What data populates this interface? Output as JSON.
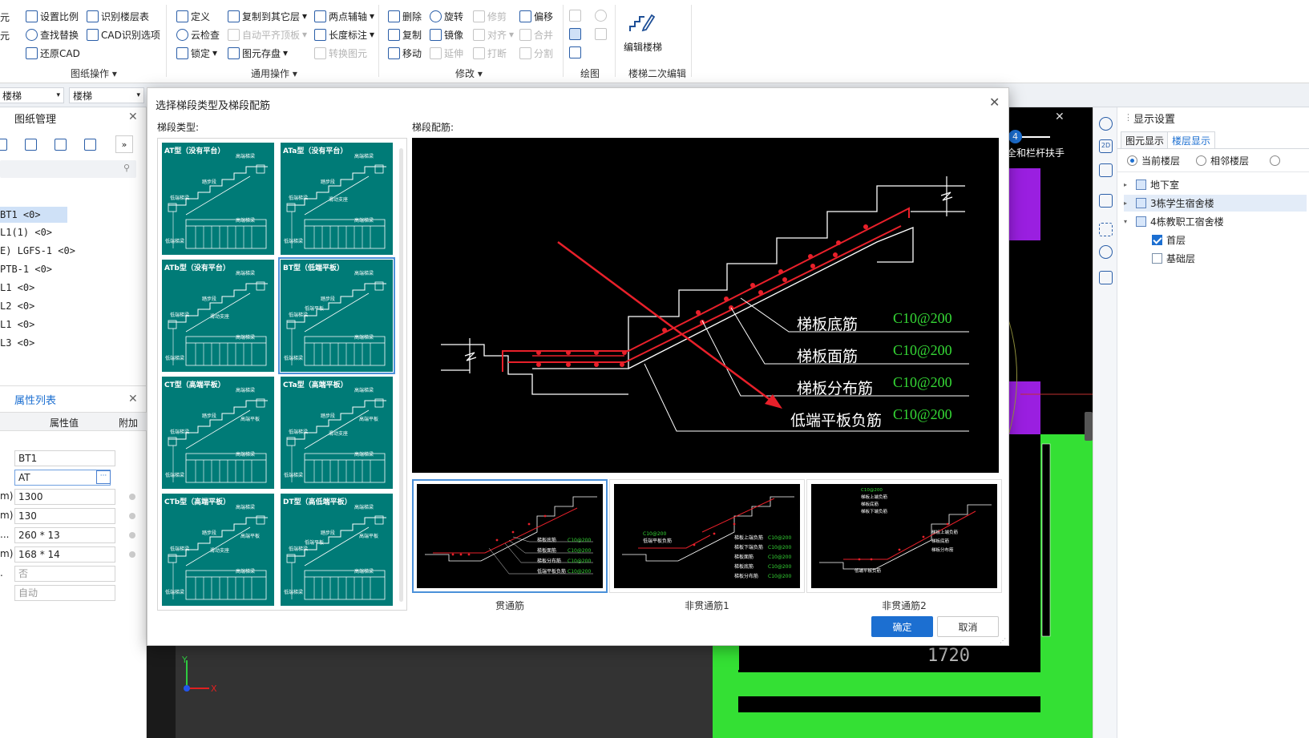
{
  "ribbon": {
    "col0": [
      "元",
      "元"
    ],
    "drawing_ops": {
      "items": [
        "设置比例",
        "识别楼层表",
        "查找替换",
        "CAD识别选项",
        "还原CAD"
      ],
      "label": "图纸操作"
    },
    "general_ops": {
      "items": [
        "定义",
        "复制到其它层",
        "两点辅轴",
        "云检查",
        "自动平齐顶板",
        "长度标注",
        "锁定",
        "图元存盘",
        "转换图元"
      ],
      "label": "通用操作"
    },
    "modify": {
      "items": [
        "删除",
        "旋转",
        "修剪",
        "偏移",
        "复制",
        "镜像",
        "对齐",
        "合并",
        "移动",
        "延伸",
        "打断",
        "分割"
      ],
      "label": "修改"
    },
    "draw": {
      "label": "绘图"
    },
    "stair_edit": {
      "button": "编辑楼梯",
      "label": "楼梯二次编辑"
    }
  },
  "toolbar2": {
    "combo1": "楼梯",
    "combo2": "楼梯"
  },
  "left": {
    "drawing_mgmt_title": "图纸管理",
    "tree_items": [
      "BT1 <0>",
      "L1(1) <0>",
      "E) LGFS-1 <0>",
      "PTB-1 <0>",
      "L1 <0>",
      "L2 <0>",
      "L1 <0>",
      "L3 <0>"
    ],
    "props_title": "属性列表",
    "props_col_value": "属性值",
    "props_col_add": "附加",
    "props_rows": [
      {
        "key": "",
        "value": "BT1"
      },
      {
        "key": "",
        "value": "AT"
      },
      {
        "key": "m)",
        "value": "1300"
      },
      {
        "key": "m)",
        "value": "130"
      },
      {
        "key": "...",
        "value": "260 * 13"
      },
      {
        "key": "m)",
        "value": "168 * 14"
      },
      {
        "key": ".",
        "value": "否"
      },
      {
        "key": "",
        "value": "自动"
      }
    ]
  },
  "canvas": {
    "label_top": "全和栏杆扶手",
    "step_badge": "4",
    "dimension": "1720"
  },
  "right": {
    "title": "显示设置",
    "tabs": [
      "图元显示",
      "楼层显示"
    ],
    "radios": [
      "当前楼层",
      "相邻楼层"
    ],
    "floors": [
      {
        "name": "地下室",
        "level": 0,
        "checked": false
      },
      {
        "name": "3栋学生宿舍楼",
        "level": 0,
        "checked": false,
        "highlight": true
      },
      {
        "name": "4栋教职工宿舍楼",
        "level": 0,
        "checked": false,
        "expanded": true
      },
      {
        "name": "首层",
        "level": 1,
        "checked": true
      },
      {
        "name": "基础层",
        "level": 1,
        "checked": false
      }
    ]
  },
  "dialog": {
    "title": "选择梯段类型及梯段配筋",
    "types_label": "梯段类型:",
    "rebar_label": "梯段配筋:",
    "types": [
      {
        "name": "AT型（没有平台）",
        "selected": false
      },
      {
        "name": "ATa型（没有平台）",
        "selected": false
      },
      {
        "name": "ATb型（没有平台）",
        "selected": false
      },
      {
        "name": "BT型（低端平板）",
        "selected": true
      },
      {
        "name": "CT型（高端平板）",
        "selected": false
      },
      {
        "name": "CTa型（高端平板）",
        "selected": false
      },
      {
        "name": "CTb型（高端平板）",
        "selected": false
      },
      {
        "name": "DT型（高低端平板）",
        "selected": false
      }
    ],
    "thumb_labels": {
      "low_beam": "低端梯梁",
      "high_beam": "高端梯梁",
      "step": "踏步段",
      "low_slab": "低端平板",
      "high_slab": "高端平板",
      "slide_support": "滑动支座",
      "slide_support_alt": "滑动支座"
    },
    "rebar_lines": [
      {
        "name": "梯板底筋",
        "spec": "C10@200"
      },
      {
        "name": "梯板面筋",
        "spec": "C10@200"
      },
      {
        "name": "梯板分布筋",
        "spec": "C10@200"
      },
      {
        "name": "低端平板负筋",
        "spec": "C10@200"
      }
    ],
    "variant_thumb": {
      "v1": [
        "梯板底筋",
        "梯板面筋",
        "梯板分布筋",
        "低端平板负筋"
      ],
      "v2_left": "低端平板负筋",
      "v2": [
        "梯板上端负筋",
        "梯板下端负筋",
        "梯板面筋",
        "梯板底筋",
        "梯板分布筋"
      ],
      "v3_top": [
        "梯板上端负筋",
        "梯板底筋",
        "梯板下端负筋"
      ],
      "v3_right": [
        "梯板上端负筋",
        "梯板底筋",
        "梯板分布筋"
      ],
      "v3_bottom": "低端平板负筋",
      "spec": "C10@200"
    },
    "variants": [
      "贯通筋",
      "非贯通筋1",
      "非贯通筋2"
    ],
    "ok": "确定",
    "cancel": "取消"
  },
  "colors": {
    "accent": "#1c6fd1",
    "teal": "#007b77",
    "green": "#34e034",
    "purple": "#9a1fe0",
    "rebar_red": "#e8202a",
    "rebar_green": "#35d835"
  }
}
